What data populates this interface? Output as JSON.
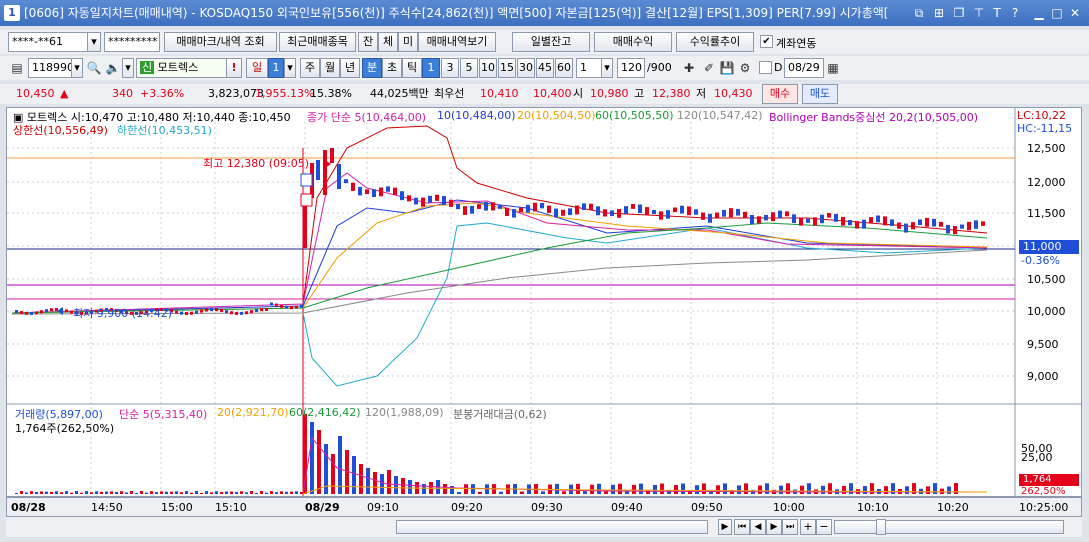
{
  "title": {
    "num": "1",
    "text": "[0606] 자동일지차트(매매내역) - KOSDAQ150 외국인보유[556(천)] 주식수[24,862(천)] 액면[500] 자본금[125(억)] 결산[12월] EPS[1,309] PER[7.99] 시가총액["
  },
  "account": {
    "number": "****-**61",
    "password": "*********",
    "buttons": [
      "매매마크/내역 조회",
      "최근매매종목",
      "잔",
      "체",
      "미",
      "매매내역보기"
    ],
    "right_buttons": [
      "일별잔고",
      "매매수익",
      "수익률추이"
    ],
    "link_label": "계좌연동"
  },
  "toolbar": {
    "code": "118990",
    "name": "모트렉스",
    "period_sel": "일",
    "period_num": "1",
    "periods": [
      "주",
      "월",
      "년",
      "분",
      "초",
      "틱"
    ],
    "intervals": [
      "1",
      "3",
      "5",
      "10",
      "15",
      "30",
      "45",
      "60"
    ],
    "interval_val": "1",
    "count": "120",
    "count_total": "/900",
    "d_label": "D",
    "date": "08/29"
  },
  "quote": {
    "price": "10,450",
    "arrow": "▲",
    "change": "340",
    "pct": "+3.36%",
    "volume": "3,823,073",
    "vol_pct": "1,955.13%",
    "turnover": "15.38%",
    "amount": "44,025백만",
    "best_bid_label": "최우선",
    "ask": "10,410",
    "bid": "10,400",
    "open_label": "시",
    "open": "10,980",
    "high_label": "고",
    "high": "12,380",
    "low_label": "저",
    "low": "10,430",
    "buy": "매수",
    "sell": "매도"
  },
  "legend": {
    "name": "모트렉스",
    "ohlc": "시:10,470 고:10,480 저:10,440 종:10,450",
    "ma_label": "종가 단순",
    "ma5": "5(10,464,00)",
    "ma10": "10(10,484,00)",
    "ma20": "20(10,504,50)",
    "ma60": "60(10,505,50)",
    "ma120": "120(10,547,42)",
    "bb": "Bollinger Bands중심선 20,2(10,505,00)",
    "upper": "상한선(10,556,49)",
    "lower": "하한선(10,453,51)",
    "lc": "LC:10,22",
    "hc": "HC:-11,15",
    "high_note": "최고 12,380 (09:05)",
    "low_note": "최저 9,900 (14:42)"
  },
  "price_axis": [
    "12,500",
    "12,000",
    "11,500",
    "11,000",
    "10,500",
    "10,000",
    "9,500",
    "9,000"
  ],
  "current_price_tag": "11,000",
  "current_pct": "-0.36%",
  "volume_legend": {
    "vol": "거래량(5,897,00)",
    "ma5": "단순 5(5,315,40)",
    "ma20": "20(2,921,70)",
    "ma60": "60(2,416,42)",
    "ma120": "120(1,988,09)",
    "amt": "분봉거래대금(0,62)",
    "current": "1,764주(262,50%)"
  },
  "volume_axis": [
    "50,00",
    "25,00"
  ],
  "volume_tag": "1,764",
  "volume_tag2": "262,50%",
  "time_axis": [
    "08/28",
    "14:50",
    "15:00",
    "15:10",
    "08/29",
    "09:10",
    "09:20",
    "09:30",
    "09:40",
    "09:50",
    "10:00",
    "10:10",
    "10:20",
    "10:25:00"
  ],
  "colors": {
    "up": "#e5001a",
    "down": "#1f4fd6",
    "ma5": "#d61fa6",
    "ma10": "#1f3bd6",
    "ma20": "#f0a000",
    "ma60": "#1a9b3a",
    "ma120": "#888888",
    "bb_up": "#cc0000",
    "bb_low": "#22aacc"
  }
}
